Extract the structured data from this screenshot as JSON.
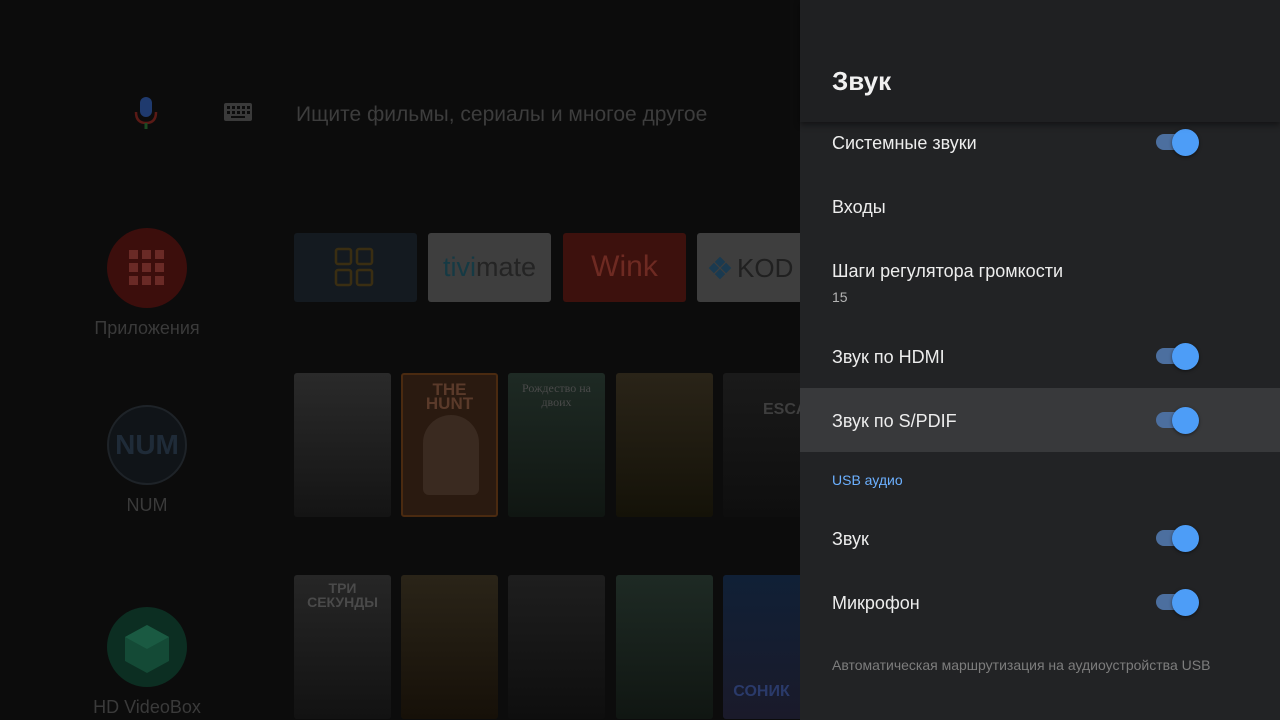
{
  "launcher": {
    "search_placeholder": "Ищите фильмы, сериалы и многое другое",
    "side_apps": [
      {
        "label": "Приложения"
      },
      {
        "label": "NUM",
        "badge": "NUM"
      },
      {
        "label": "HD VideoBox"
      }
    ],
    "app_cards": [
      {
        "name": "apps-grid"
      },
      {
        "name": "TiviMate",
        "text_a": "tivi",
        "text_b": "mate"
      },
      {
        "name": "Wink",
        "text": "Wink"
      },
      {
        "name": "Kodi",
        "text": "KOD"
      }
    ],
    "posters_row1": [
      {
        "title": ""
      },
      {
        "title": "THE HUNT"
      },
      {
        "title": "Рождество на двоих"
      },
      {
        "title": ""
      },
      {
        "title": "ESCA"
      }
    ],
    "posters_row2": [
      {
        "title": "ТРИ СЕКУНДЫ"
      },
      {
        "title": ""
      },
      {
        "title": ""
      },
      {
        "title": ""
      },
      {
        "title": "СОНИК"
      }
    ]
  },
  "panel": {
    "title": "Звук",
    "items": [
      {
        "label": "Системные звуки",
        "toggle": true
      },
      {
        "label": "Входы"
      },
      {
        "label": "Шаги регулятора громкости",
        "value": "15"
      },
      {
        "label": "Звук по HDMI",
        "toggle": true
      },
      {
        "label": "Звук по S/PDIF",
        "toggle": true,
        "focused": true
      }
    ],
    "section": "USB аудио",
    "usb_items": [
      {
        "label": "Звук",
        "toggle": true
      },
      {
        "label": "Микрофон",
        "toggle": true
      }
    ],
    "footnote": "Автоматическая маршрутизация на аудиоустройства USB"
  },
  "colors": {
    "panel_bg": "#222325",
    "accent": "#4d9df7",
    "section_header": "#6cb0ff",
    "focused_row": "#38393b"
  }
}
